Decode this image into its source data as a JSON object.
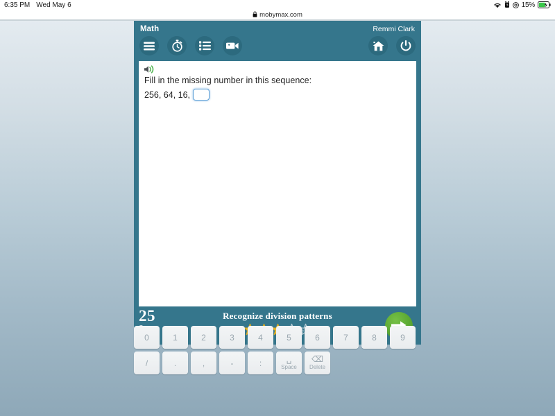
{
  "status_bar": {
    "time": "6:35 PM",
    "date": "Wed May 6",
    "battery_percent": "15%",
    "icons": [
      "wifi-icon",
      "alarm-icon",
      "do-not-disturb-icon",
      "battery-charging-icon"
    ]
  },
  "browser": {
    "lock_icon": "lock-icon",
    "url": "mobymax.com"
  },
  "app": {
    "title": "Math",
    "user": "Remmi Clark",
    "accent_color": "#35768c",
    "toolbar_left": [
      {
        "name": "menu-button",
        "icon": "hamburger-menu-icon"
      },
      {
        "name": "timer-button",
        "icon": "stopwatch-icon"
      },
      {
        "name": "list-button",
        "icon": "list-icon"
      },
      {
        "name": "video-button",
        "icon": "video-camera-icon"
      }
    ],
    "toolbar_right": [
      {
        "name": "home-button",
        "icon": "home-icon"
      },
      {
        "name": "power-button",
        "icon": "power-icon"
      }
    ],
    "lesson": {
      "speaker_icon": "speaker-icon",
      "prompt": "Fill in the missing number in this sequence:",
      "sequence_prefix": "256, 64, 16,",
      "answer_value": "",
      "answer_placeholder": ""
    },
    "footer": {
      "bonus_number": "25",
      "bonus_label_line1": "Game",
      "bonus_label_line2": "Bonus",
      "skill_name": "Recognize division patterns",
      "stars_filled": 3,
      "stars_total": 5,
      "star_fill_color": "#f4c430",
      "next_button_icon": "arrow-right-icon",
      "next_button_color": "#5aa832"
    }
  },
  "keyboard": {
    "row1": [
      "0",
      "1",
      "2",
      "3",
      "4",
      "5",
      "6",
      "7",
      "8",
      "9"
    ],
    "row2": [
      {
        "glyph": "/",
        "sub": ""
      },
      {
        "glyph": ".",
        "sub": ""
      },
      {
        "glyph": ",",
        "sub": ""
      },
      {
        "glyph": "-",
        "sub": ""
      },
      {
        "glyph": ":",
        "sub": ""
      },
      {
        "glyph": "␣",
        "sub": "Space"
      },
      {
        "glyph": "⌫",
        "sub": "Delete"
      }
    ]
  }
}
